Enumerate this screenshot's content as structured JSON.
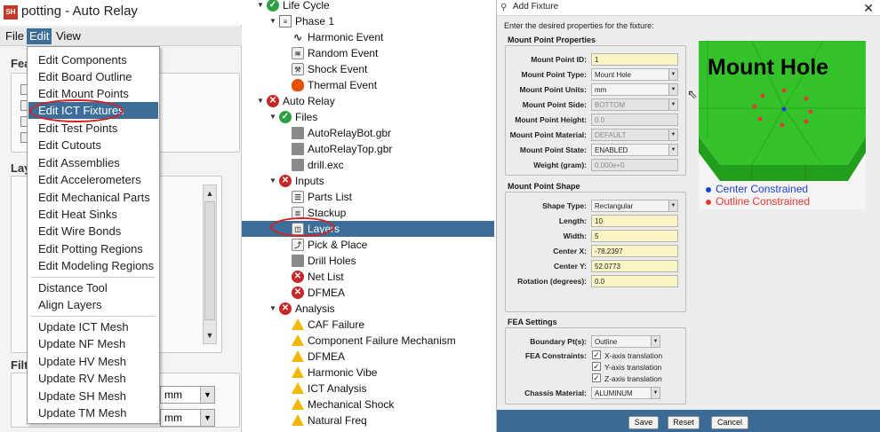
{
  "left_app": {
    "logo": "SH",
    "title": "potting - Auto Relay",
    "menubar": {
      "file": "File",
      "edit": "Edit",
      "view": "View"
    },
    "fragments": {
      "fea": "Fea",
      "lay": "Lay",
      "filt": "Filt"
    },
    "unit_selects": [
      "mm",
      "mm"
    ],
    "edit_menu": {
      "group1": [
        "Edit Components",
        "Edit Board Outline",
        "Edit Mount Points",
        "Edit ICT Fixtures",
        "Edit Test Points",
        "Edit Cutouts",
        "Edit Assemblies",
        "Edit Accelerometers",
        "Edit Mechanical Parts",
        "Edit Heat Sinks",
        "Edit Wire Bonds",
        "Edit Potting Regions",
        "Edit Modeling Regions"
      ],
      "group2": [
        "Distance Tool",
        "Align Layers"
      ],
      "group3": [
        "Update ICT Mesh",
        "Update NF Mesh",
        "Update HV Mesh",
        "Update RV Mesh",
        "Update SH Mesh",
        "Update TM Mesh"
      ],
      "highlighted": "Edit ICT Fixtures"
    }
  },
  "tree": {
    "nodes": [
      {
        "label": "Life Cycle",
        "icon": "check-icon"
      },
      {
        "label": "Phase 1",
        "icon": "document-icon"
      },
      {
        "label": "Harmonic Event",
        "icon": "wave-icon"
      },
      {
        "label": "Random Event",
        "icon": "random-icon"
      },
      {
        "label": "Shock Event",
        "icon": "hammer-icon"
      },
      {
        "label": "Thermal Event",
        "icon": "flame-icon"
      },
      {
        "label": "Auto Relay",
        "icon": "error-icon"
      },
      {
        "label": "Files",
        "icon": "check-icon"
      },
      {
        "label": "AutoRelayBot.gbr",
        "icon": "gerber-icon"
      },
      {
        "label": "AutoRelayTop.gbr",
        "icon": "gerber-icon"
      },
      {
        "label": "drill.exc",
        "icon": "drill-file-icon"
      },
      {
        "label": "Inputs",
        "icon": "error-icon"
      },
      {
        "label": "Parts List",
        "icon": "list-icon"
      },
      {
        "label": "Stackup",
        "icon": "stack-icon"
      },
      {
        "label": "Layers",
        "icon": "layers-icon"
      },
      {
        "label": "Pick & Place",
        "icon": "pick-place-icon"
      },
      {
        "label": "Drill Holes",
        "icon": "drill-holes-icon"
      },
      {
        "label": "Net List",
        "icon": "error-icon"
      },
      {
        "label": "DFMEA",
        "icon": "error-icon"
      },
      {
        "label": "Analysis",
        "icon": "error-icon"
      },
      {
        "label": "CAF Failure",
        "icon": "warning-icon"
      },
      {
        "label": "Component Failure Mechanism",
        "icon": "warning-icon"
      },
      {
        "label": "DFMEA",
        "icon": "warning-icon"
      },
      {
        "label": "Harmonic Vibe",
        "icon": "warning-icon"
      },
      {
        "label": "ICT Analysis",
        "icon": "warning-icon"
      },
      {
        "label": "Mechanical Shock",
        "icon": "warning-icon"
      },
      {
        "label": "Natural Freq",
        "icon": "warning-icon"
      }
    ],
    "selected": "Layers"
  },
  "dialog": {
    "title": "Add Fixture",
    "close": "✕",
    "intro": "Enter the desired properties for the fixture:",
    "mount_point_properties": {
      "heading": "Mount Point Properties",
      "id_label": "Mount Point ID:",
      "id_value": "1",
      "type_label": "Mount Point Type:",
      "type_value": "Mount Hole",
      "units_label": "Mount Point Units:",
      "units_value": "mm",
      "side_label": "Mount Point Side:",
      "side_value": "BOTTOM",
      "height_label": "Mount Point Height:",
      "height_value": "0.0",
      "material_label": "Mount Point Material:",
      "material_value": "DEFAULT",
      "state_label": "Mount Point State:",
      "state_value": "ENABLED",
      "weight_label": "Weight (gram):",
      "weight_value": "0.000e+0"
    },
    "mount_point_shape": {
      "heading": "Mount Point Shape",
      "shape_type_label": "Shape Type:",
      "shape_type_value": "Rectangular",
      "length_label": "Length:",
      "length_value": "10",
      "width_label": "Width:",
      "width_value": "5",
      "center_x_label": "Center X:",
      "center_x_value": "-78.2397",
      "center_y_label": "Center Y:",
      "center_y_value": "52.0773",
      "rotation_label": "Rotation (degrees):",
      "rotation_value": "0.0"
    },
    "fea_settings": {
      "heading": "FEA Settings",
      "boundary_label": "Boundary Pt(s):",
      "boundary_value": "Outline",
      "constraints_label": "FEA Constraints:",
      "x_translation": "X-axis translation",
      "y_translation": "Y-axis translation",
      "z_translation": "Z-axis translation",
      "chassis_label": "Chassis Material:",
      "chassis_value": "ALUMINUM",
      "x_checked": true,
      "y_checked": true,
      "z_checked": true
    },
    "preview": {
      "title": "Mount Hole",
      "legend_center": "Center Constrained",
      "legend_outline": "Outline Constrained",
      "center_color": "#1f3fd1",
      "outline_color": "#e53935",
      "board_color": "#34c22a"
    },
    "buttons": {
      "save": "Save",
      "reset": "Reset",
      "cancel": "Cancel"
    }
  },
  "colors": {
    "selection": "#3d6e9a",
    "annotation": "#d62020"
  }
}
